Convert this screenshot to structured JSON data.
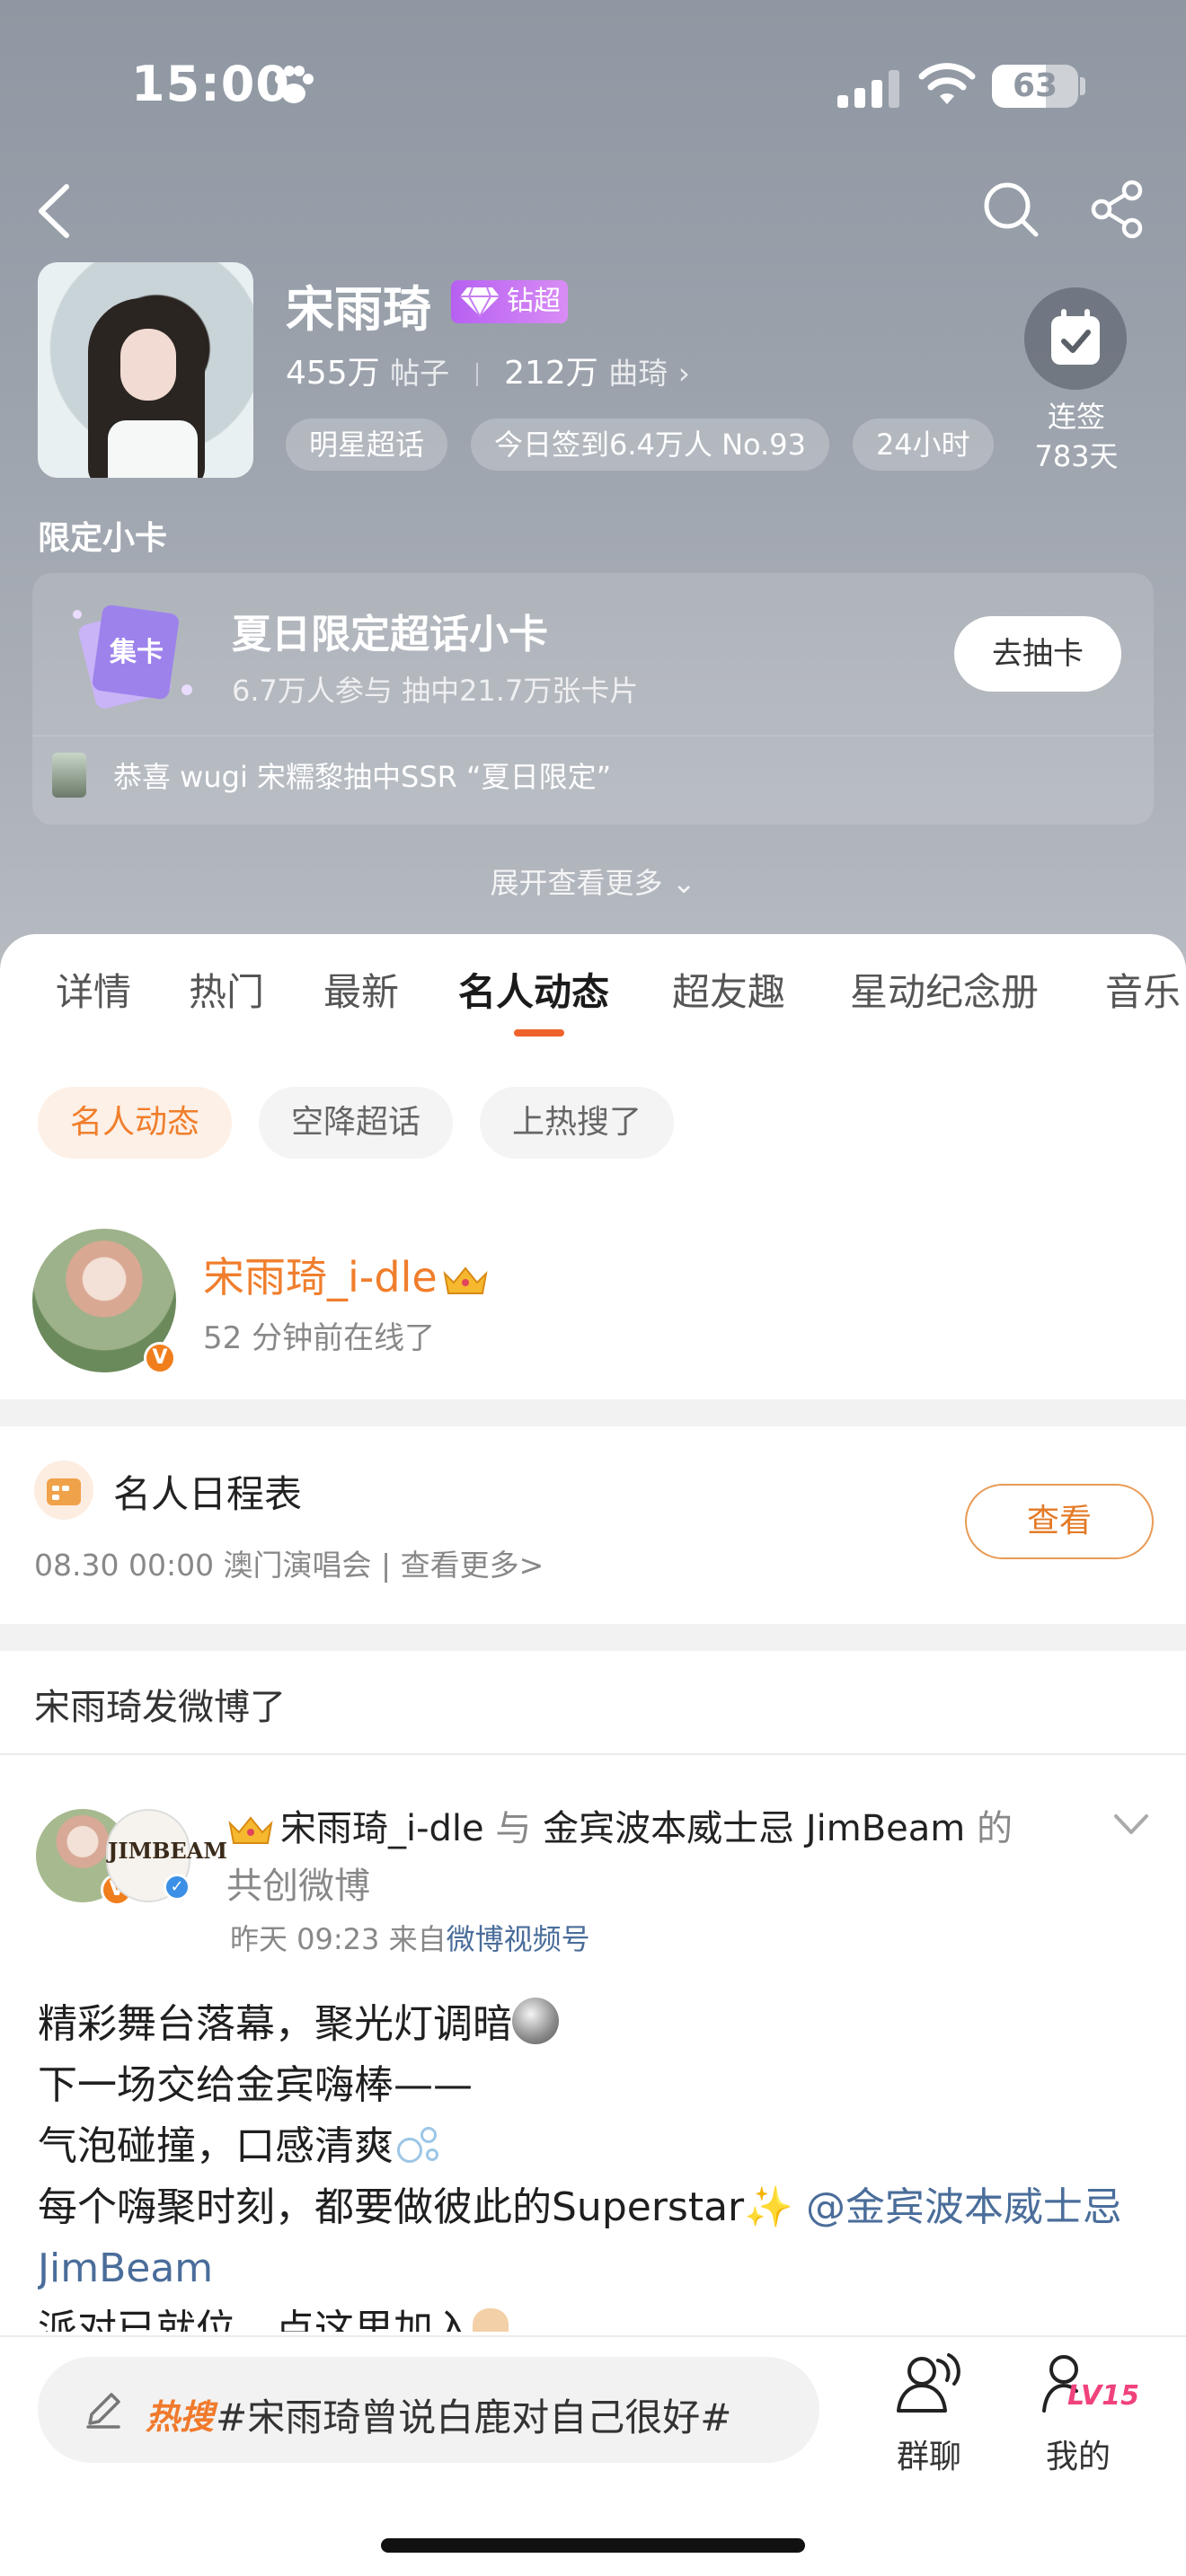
{
  "status_bar": {
    "time": "15:00",
    "battery": "63",
    "battery_level_percent": 63
  },
  "header": {
    "topic_name": "宋雨琦",
    "badge": "钻超",
    "posts_count": "455万",
    "posts_label": "帖子",
    "fans_count": "212万",
    "fans_label": "曲琦",
    "chips": [
      "明星超话",
      "今日签到6.4万人 No.93",
      "24小时"
    ],
    "signin": {
      "label": "连签",
      "days": "783天"
    }
  },
  "limited_card": {
    "section_title": "限定小卡",
    "icon_text": "集卡",
    "title": "夏日限定超话小卡",
    "subtitle": "6.7万人参与 抽中21.7万张卡片",
    "button": "去抽卡",
    "winner_text": "恭喜 wugi 宋糯黎抽中SSR “夏日限定”"
  },
  "expand_more": "展开查看更多",
  "tabs": [
    {
      "label": "详情"
    },
    {
      "label": "热门"
    },
    {
      "label": "最新"
    },
    {
      "label": "名人动态",
      "active": true
    },
    {
      "label": "超友趣"
    },
    {
      "label": "星动纪念册"
    },
    {
      "label": "音乐"
    }
  ],
  "filters": [
    {
      "label": "名人动态",
      "active": true
    },
    {
      "label": "空降超话"
    },
    {
      "label": "上热搜了"
    }
  ],
  "celebrity": {
    "name": "宋雨琦_i-dle",
    "status": "52 分钟前在线了",
    "verified_badge": "V"
  },
  "schedule": {
    "title": "名人日程表",
    "detail": "08.30 00:00 澳门演唱会 |",
    "more": "查看更多>",
    "button": "查看"
  },
  "posted_section": {
    "title": "宋雨琦发微博了"
  },
  "post": {
    "author": "宋雨琦_i-dle",
    "connector": "与",
    "coauthor": "金宾波本威士忌 JimBeam",
    "suffix": "的",
    "line2": "共创微博",
    "time": "昨天 09:23",
    "source_prefix": "来自",
    "source": "微博视频号",
    "coauthor_logo_text": "JIMBEAM",
    "body": {
      "line1": "精彩舞台落幕，聚光灯调暗",
      "line2": "下一场交给金宾嗨棒——",
      "line3": "气泡碰撞，口感清爽",
      "line4": "每个嗨聚时刻，都要做彼此的Superstar",
      "mention": "@金宾波本威士忌 JimBeam",
      "line5": "派对已就位，点这里加入"
    }
  },
  "bottom_bar": {
    "hot_tag": "热搜",
    "hot_text": "#宋雨琦曾说白鹿对自己很好#",
    "group_chat": "群聊",
    "me": "我的",
    "level": "LV15"
  },
  "colors": {
    "accent_orange": "#f07e2c",
    "tab_underline": "#f0622c",
    "link_blue": "#4a6d9a",
    "badge_purple": "#b660f2",
    "level_pink": "#f0427b"
  },
  "icons": {
    "status": [
      "paw-icon",
      "signal-icon",
      "wifi-icon",
      "battery-icon"
    ],
    "header": [
      "back-icon",
      "search-icon",
      "share-icon",
      "calendar-check-icon"
    ],
    "bottom": [
      "pencil-icon",
      "group-chat-icon",
      "profile-icon"
    ]
  }
}
